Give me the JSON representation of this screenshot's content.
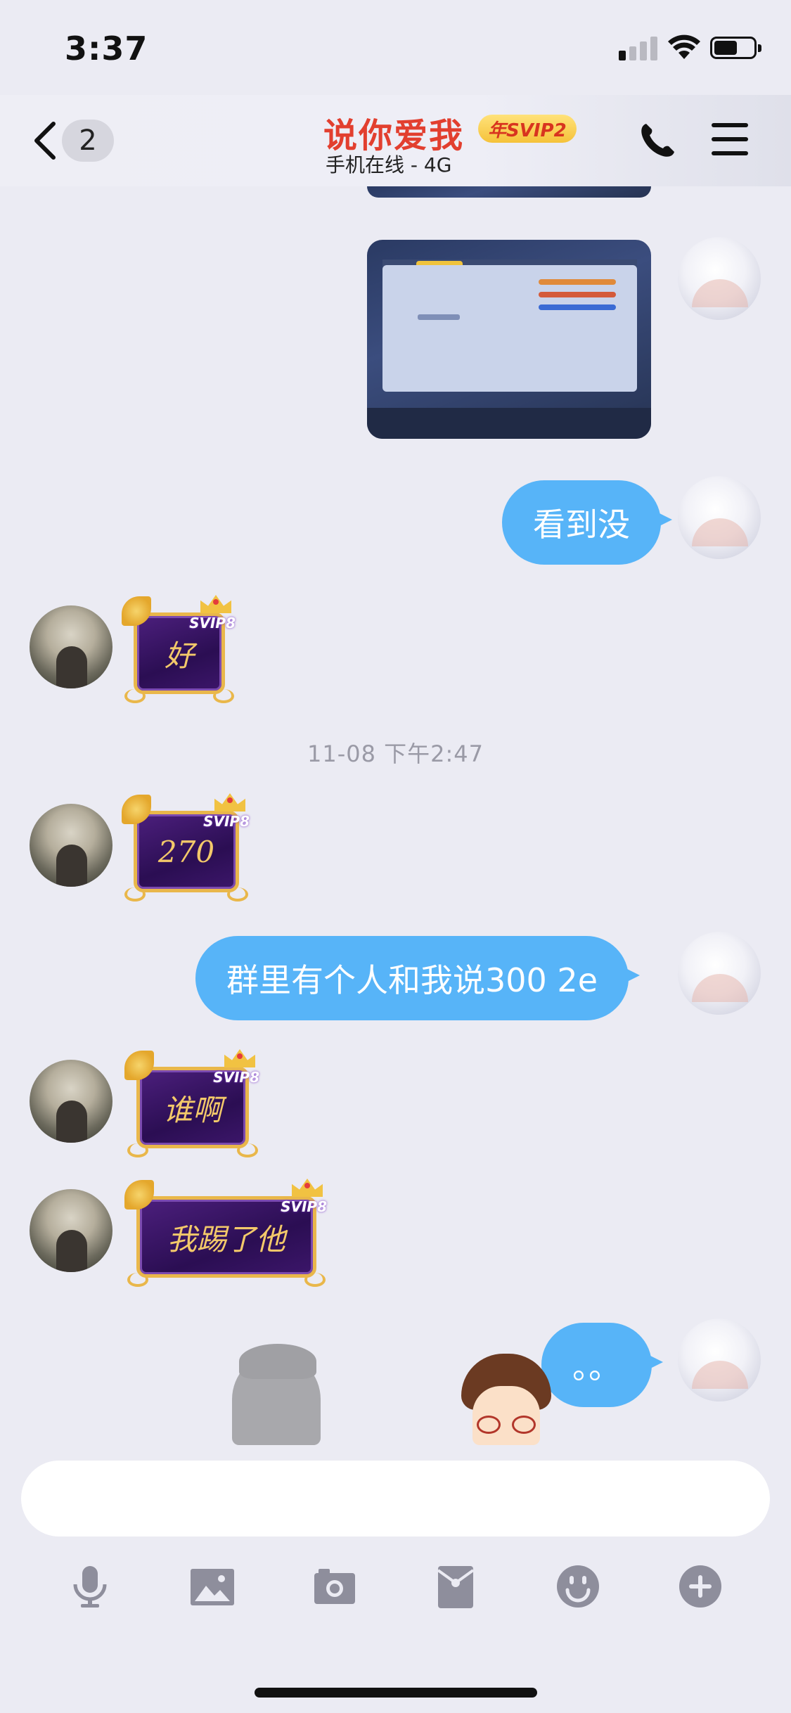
{
  "status_bar": {
    "time": "3:37",
    "signal_bars_on": 1,
    "battery_level": 0.55
  },
  "header": {
    "unread_count": "2",
    "contact_name": "说你爱我",
    "svip_label": "年SVIP2",
    "online_status": "手机在线 - 4G",
    "colors": {
      "name": "#e23f2f",
      "badge_bg": "#f5c23a"
    }
  },
  "messages": [
    {
      "sender": "me",
      "type": "image",
      "content": "game-stats-screenshot"
    },
    {
      "sender": "me",
      "type": "text",
      "text": "看到没"
    },
    {
      "sender": "other",
      "type": "vip_sticker_text",
      "text": "好",
      "vip_tag": "SVIP8"
    },
    {
      "type": "timestamp",
      "text": "11-08 下午2:47"
    },
    {
      "sender": "other",
      "type": "vip_sticker_text",
      "text": "270",
      "vip_tag": "SVIP8"
    },
    {
      "sender": "me",
      "type": "text",
      "text": "群里有个人和我说300 2e"
    },
    {
      "sender": "other",
      "type": "vip_sticker_text",
      "text": "谁啊",
      "vip_tag": "SVIP8"
    },
    {
      "sender": "other",
      "type": "vip_sticker_text",
      "text": "我踢了他",
      "vip_tag": "SVIP8"
    },
    {
      "sender": "me",
      "type": "text",
      "text": "。。"
    }
  ],
  "input": {
    "value": "",
    "placeholder": ""
  },
  "toolbar_icons": [
    "microphone-icon",
    "image-icon",
    "camera-icon",
    "red-packet-icon",
    "emoji-icon",
    "plus-icon"
  ],
  "colors": {
    "bubble_me": "#57b4f8",
    "background": "#ebebf3",
    "vip_gold": "#e9b74a",
    "vip_purple": "#4c1f7d",
    "icon_gray": "#8e8e9c"
  }
}
